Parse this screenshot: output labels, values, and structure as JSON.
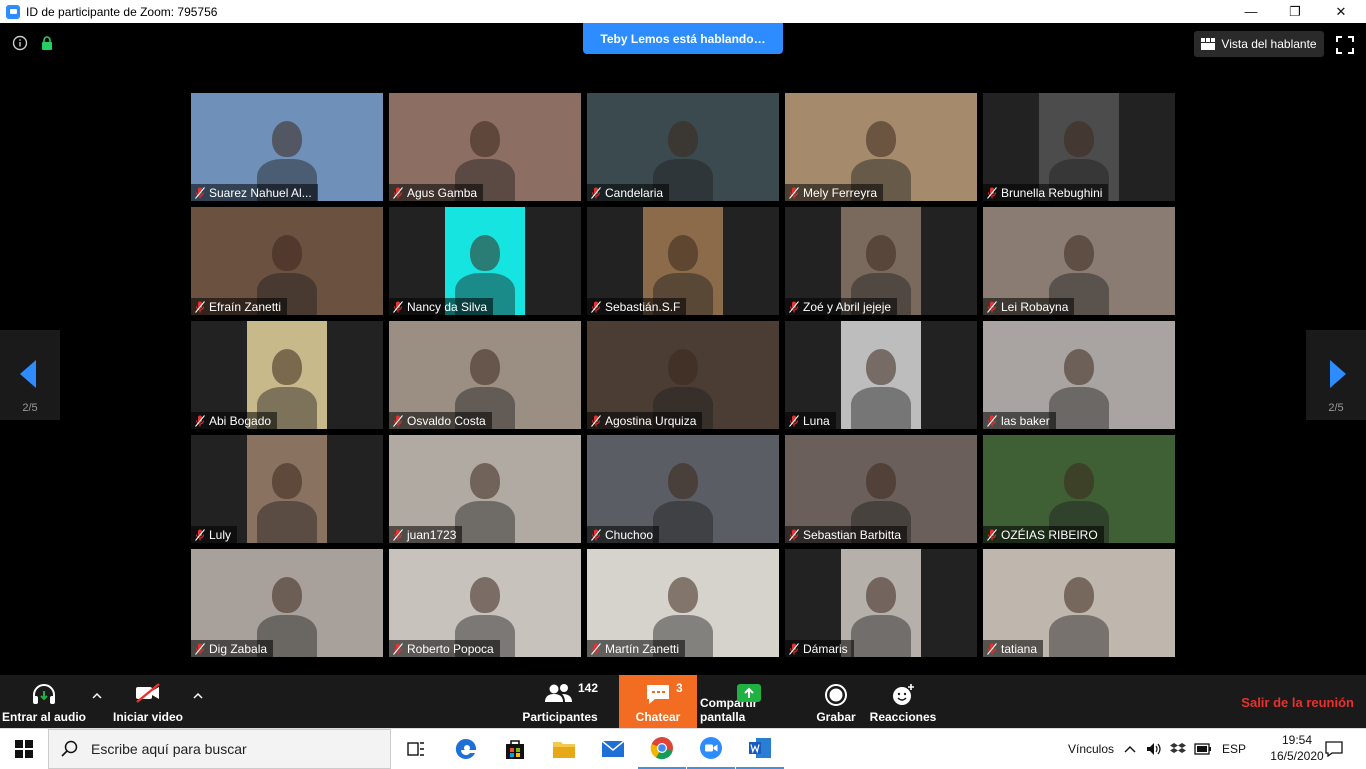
{
  "window": {
    "title": "ID de participante de Zoom: 795756",
    "minimize": "—",
    "restore": "❐",
    "close": "✕"
  },
  "meeting": {
    "speaking_banner": "Teby Lemos está hablando…",
    "view_button": "Vista del hablante",
    "page_left": "2/5",
    "page_right": "2/5"
  },
  "participants": [
    {
      "name": "Suarez Nahuel Al...",
      "bg": "#6f90b8",
      "colorful": false
    },
    {
      "name": "Agus Gamba",
      "bg": "#8d6e63",
      "colorful": false
    },
    {
      "name": "Candelaria",
      "bg": "#3b4a4f",
      "colorful": false
    },
    {
      "name": "Mely Ferreyra",
      "bg": "#a58a6c",
      "colorful": false
    },
    {
      "name": "Brunella Rebughini",
      "bg": "#4c4c4c",
      "colorful": false
    },
    {
      "name": "Efraín Zanetti",
      "bg": "#6b5140",
      "colorful": false
    },
    {
      "name": "Nancy da Silva",
      "bg": "#16e4e0",
      "colorful": true
    },
    {
      "name": "Sebastián.S.F",
      "bg": "#8b6b4a",
      "colorful": false
    },
    {
      "name": "Zoé y Abril jejeje",
      "bg": "#7a6a5e",
      "colorful": false
    },
    {
      "name": "Lei Robayna",
      "bg": "#8a7c72",
      "colorful": false
    },
    {
      "name": "Abi Bogado",
      "bg": "#c8b98a",
      "colorful": false
    },
    {
      "name": "Osvaldo Costa",
      "bg": "#9b8f84",
      "colorful": false
    },
    {
      "name": "Agostina Urquiza",
      "bg": "#4b3c34",
      "colorful": false
    },
    {
      "name": "Luna",
      "bg": "#bdbdbd",
      "colorful": false
    },
    {
      "name": "las baker",
      "bg": "#a9a4a1",
      "colorful": false
    },
    {
      "name": "Luly",
      "bg": "#8a7261",
      "colorful": false
    },
    {
      "name": "juan1723",
      "bg": "#b1aaa2",
      "colorful": false
    },
    {
      "name": "Chuchoo",
      "bg": "#5a5d63",
      "colorful": false
    },
    {
      "name": "Sebastian Barbitta",
      "bg": "#6a5f5a",
      "colorful": false
    },
    {
      "name": "OZÉIAS RIBEIRO",
      "bg": "#3f5f35",
      "colorful": false
    },
    {
      "name": "Dig Zabala",
      "bg": "#a8a09a",
      "colorful": false
    },
    {
      "name": "Roberto Popoca",
      "bg": "#c7c2bc",
      "colorful": false
    },
    {
      "name": "Martín Zanetti",
      "bg": "#d6d2cc",
      "colorful": false
    },
    {
      "name": "Dámaris",
      "bg": "#b6b0ab",
      "colorful": false
    },
    {
      "name": "tatiana",
      "bg": "#bfb7ae",
      "colorful": false
    }
  ],
  "toolbar": {
    "audio": "Entrar al audio",
    "video": "Iniciar video",
    "participants": "Participantes",
    "participants_count": "142",
    "chat": "Chatear",
    "chat_count": "3",
    "share": "Compartir pantalla",
    "record": "Grabar",
    "reactions": "Reacciones",
    "leave": "Salir de la reunión"
  },
  "taskbar": {
    "search_placeholder": "Escribe aquí para buscar",
    "links": "Vínculos",
    "lang": "ESP",
    "time": "19:54",
    "date": "16/5/2020"
  },
  "colors": {
    "accent": "#2d8cff",
    "chat": "#f26d21",
    "leave": "#e8312f",
    "share": "#1fb141"
  }
}
